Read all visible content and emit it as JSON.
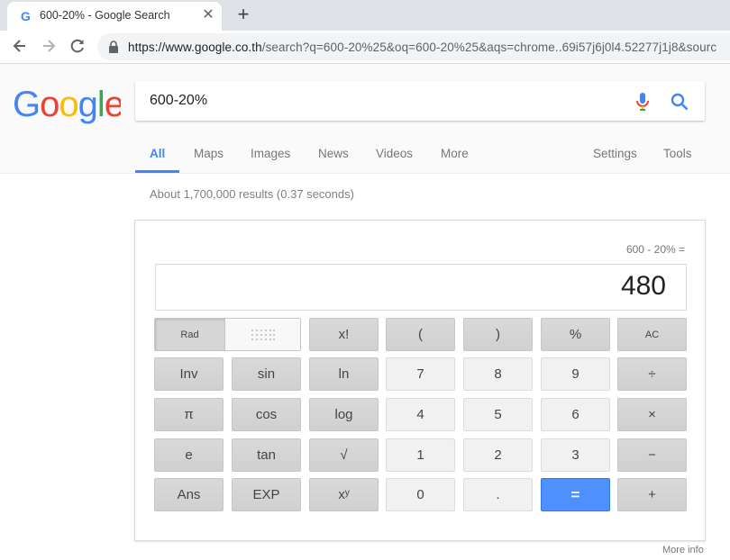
{
  "browser": {
    "tab_title": "600-20% - Google Search",
    "tab_close": "✕",
    "new_tab": "+",
    "url_main": "https://www.google.co.th",
    "url_rest": "/search?q=600-20%25&oq=600-20%25&aqs=chrome..69i57j6j0l4.52277j1j8&sourc"
  },
  "search": {
    "query": "600-20%",
    "logo_text": "Google"
  },
  "nav": {
    "tabs": [
      "All",
      "Maps",
      "Images",
      "News",
      "Videos",
      "More"
    ],
    "settings": "Settings",
    "tools": "Tools"
  },
  "result_stats": "About 1,700,000 results (0.37 seconds)",
  "calculator": {
    "expression": "600 - 20% =",
    "display": "480",
    "rad_label": "Rad",
    "rows": [
      [
        "x!",
        "(",
        ")",
        "%",
        "AC"
      ],
      [
        "Inv",
        "sin",
        "ln",
        "7",
        "8",
        "9",
        "÷"
      ],
      [
        "π",
        "cos",
        "log",
        "4",
        "5",
        "6",
        "×"
      ],
      [
        "e",
        "tan",
        "√",
        "1",
        "2",
        "3",
        "−"
      ],
      [
        "Ans",
        "EXP",
        "xʸ",
        "0",
        ".",
        "=",
        "+"
      ]
    ]
  },
  "more_info": "More info",
  "colors": {
    "blue": "#4285f4",
    "red": "#ea4335",
    "yellow": "#fbbc05",
    "green": "#34a853",
    "equals_button": "#4d90fe"
  }
}
